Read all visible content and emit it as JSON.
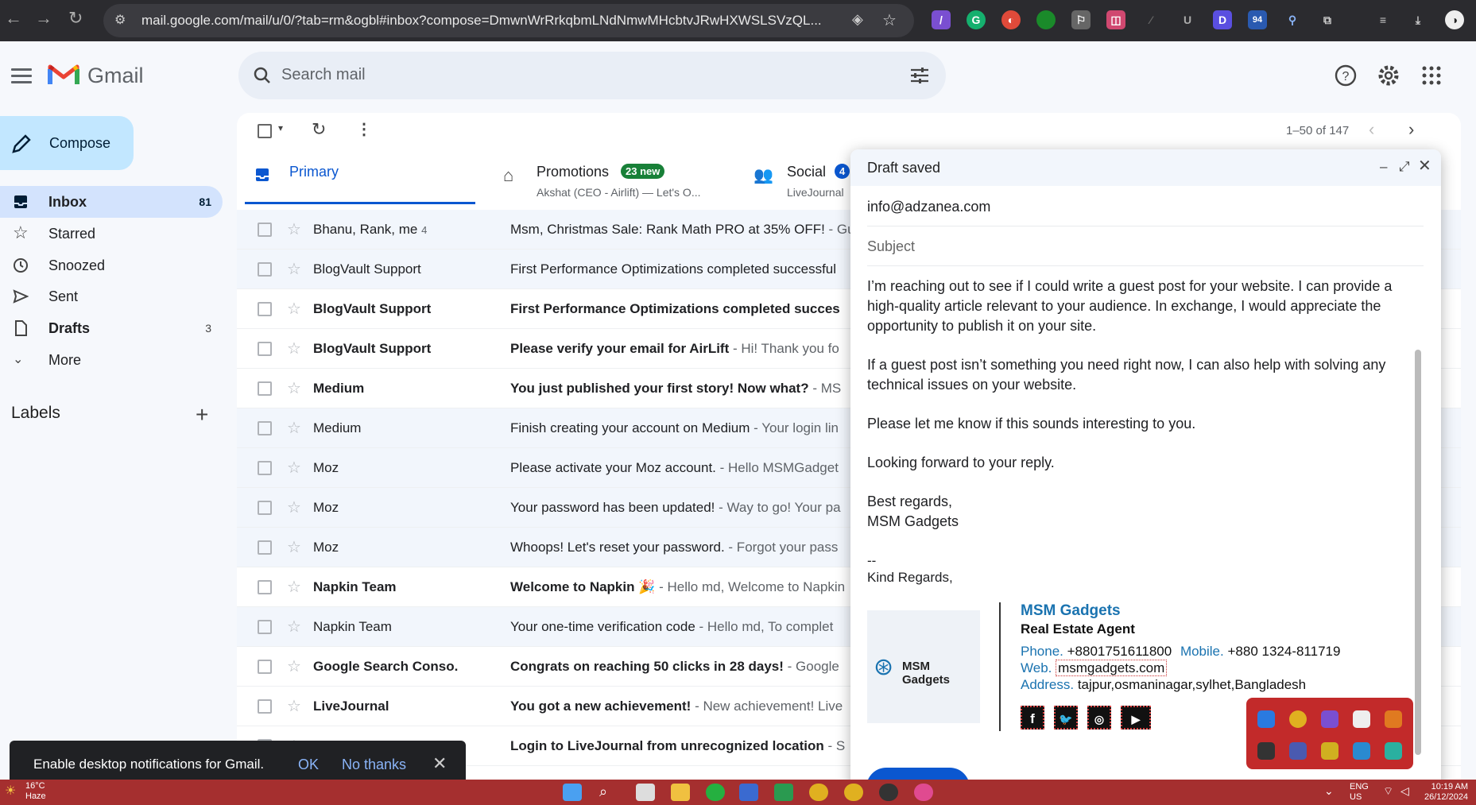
{
  "browser": {
    "url": "mail.google.com/mail/u/0/?tab=rm&ogbl#inbox?compose=DmwnWrRrkqbmLNdNmwMHcbtvJRwHXWSLSVzQL..."
  },
  "app": {
    "name": "Gmail",
    "search_placeholder": "Search mail"
  },
  "sidebar": {
    "compose_label": "Compose",
    "items": [
      {
        "label": "Inbox",
        "count": "81"
      },
      {
        "label": "Starred",
        "count": ""
      },
      {
        "label": "Snoozed",
        "count": ""
      },
      {
        "label": "Sent",
        "count": ""
      },
      {
        "label": "Drafts",
        "count": "3"
      },
      {
        "label": "More",
        "count": ""
      }
    ],
    "labels_title": "Labels"
  },
  "toolbar": {
    "page_count": "1–50 of 147"
  },
  "tabs": [
    {
      "label": "Primary",
      "sub": ""
    },
    {
      "label": "Promotions",
      "badge": "23 new",
      "sub": "Akshat (CEO - Airlift) — Let's O..."
    },
    {
      "label": "Social",
      "badge": "4",
      "sub": "LiveJournal"
    }
  ],
  "emails": [
    {
      "from": "Bhanu, Rank, me",
      "count": "4",
      "subject": "Msm, Christmas Sale: Rank Math PRO at 35% OFF!",
      "snippet": " - Gu",
      "unread": false
    },
    {
      "from": "BlogVault Support",
      "count": "",
      "subject": "First Performance Optimizations completed successful",
      "snippet": "",
      "unread": false
    },
    {
      "from": "BlogVault Support",
      "count": "",
      "subject": "First Performance Optimizations completed succes",
      "snippet": "",
      "unread": true
    },
    {
      "from": "BlogVault Support",
      "count": "",
      "subject": "Please verify your email for AirLift",
      "snippet": " - Hi! Thank you fo",
      "unread": true
    },
    {
      "from": "Medium",
      "count": "",
      "subject": "You just published your first story! Now what?",
      "snippet": " - MS",
      "unread": true
    },
    {
      "from": "Medium",
      "count": "",
      "subject": "Finish creating your account on Medium",
      "snippet": " - Your login lin",
      "unread": false
    },
    {
      "from": "Moz",
      "count": "",
      "subject": "Please activate your Moz account.",
      "snippet": " - Hello MSMGadget",
      "unread": false
    },
    {
      "from": "Moz",
      "count": "",
      "subject": "Your password has been updated!",
      "snippet": " - Way to go! Your pa",
      "unread": false
    },
    {
      "from": "Moz",
      "count": "",
      "subject": "Whoops! Let's reset your password.",
      "snippet": " - Forgot your pass",
      "unread": false
    },
    {
      "from": "Napkin Team",
      "count": "",
      "subject": "Welcome to Napkin 🎉",
      "snippet": " - Hello md, Welcome to Napkin",
      "unread": true
    },
    {
      "from": "Napkin Team",
      "count": "",
      "subject": "Your one-time verification code",
      "snippet": " - Hello md, To complet",
      "unread": false
    },
    {
      "from": "Google Search Conso.",
      "count": "",
      "subject": "Congrats on reaching 50 clicks in 28 days!",
      "snippet": " - Google",
      "unread": true
    },
    {
      "from": "LiveJournal",
      "count": "",
      "subject": "You got a new achievement!",
      "snippet": " - New achievement! Live",
      "unread": true
    },
    {
      "from": "lj_notify",
      "count": "",
      "subject": "Login to LiveJournal from unrecognized location",
      "snippet": " - S",
      "unread": true
    }
  ],
  "compose": {
    "title": "Draft saved",
    "to": "info@adzanea.com",
    "subject_placeholder": "Subject",
    "paragraphs": [
      "I’m reaching out to see if I could write a guest post for your website. I can provide a high-quality article relevant to your audience. In exchange, I would appreciate the opportunity to publish it on your site.",
      "If a guest post isn’t something you need right now, I can also help with solving any technical issues on your website.",
      "Please let me know if this sounds interesting to you.",
      "Looking forward to your reply."
    ],
    "closing": "Best regards,",
    "closing_name": "MSM Gadgets",
    "sig_dash": "--",
    "sig_kind": "Kind Regards,",
    "signature": {
      "logo_text": "MSM Gadgets",
      "name": "MSM Gadgets",
      "role": "Real Estate Agent",
      "phone_label": "Phone.",
      "phone": "+8801751611800",
      "mobile_label": "Mobile.",
      "mobile": "+880 1324-811719",
      "web_label": "Web.",
      "web": "msmgadgets.com",
      "address_label": "Address.",
      "address": "tajpur,osmaninagar,sylhet,Bangladesh",
      "social": [
        "f",
        "t",
        "ig",
        "yt"
      ]
    }
  },
  "notification": {
    "text": "Enable desktop notifications for Gmail.",
    "ok": "OK",
    "no": "No thanks"
  },
  "taskbar": {
    "temp": "16°C",
    "weather": "Haze",
    "lang1": "ENG",
    "lang2": "US",
    "time": "10:19 AM",
    "date": "26/12/2024"
  },
  "colors": {
    "accent": "#0b57d0",
    "compose_bg": "#c2e7ff",
    "tray_bg": "#c22a2a",
    "taskbar_bg": "#a52f2f"
  }
}
